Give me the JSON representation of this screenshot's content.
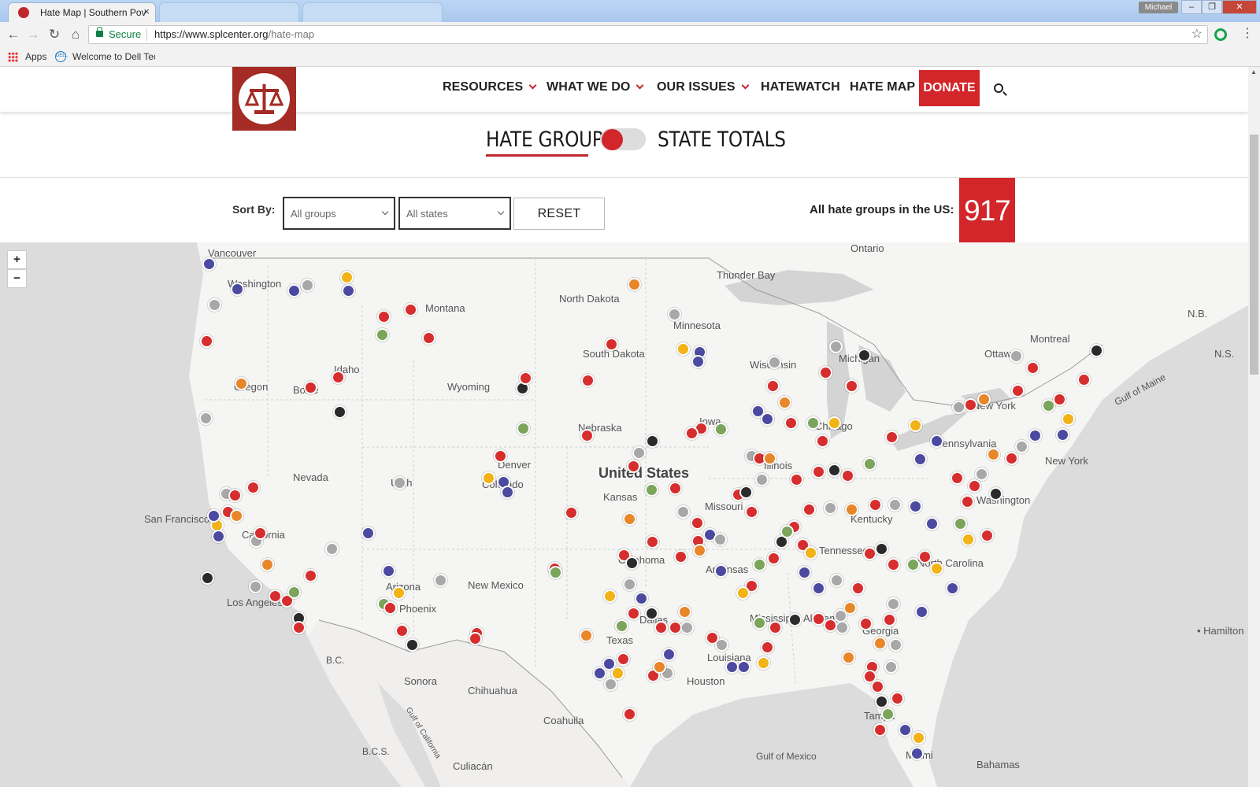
{
  "browser": {
    "tabs": [
      {
        "title": "Hate Map | Southern Pov",
        "close": "×"
      },
      {
        "title": "",
        "close": ""
      },
      {
        "title": "",
        "close": ""
      }
    ],
    "user": "Michael",
    "url_secure": "Secure",
    "url_host": "https://www.splcenter.org",
    "url_path": "/hate-map",
    "bookmarks": {
      "apps": "Apps",
      "dell": "Welcome to Dell Tech"
    }
  },
  "nav": {
    "items": [
      "RESOURCES",
      "WHAT WE DO",
      "OUR ISSUES",
      "HATEWATCH",
      "HATE MAP"
    ],
    "donate": "DONATE"
  },
  "toggle": {
    "left": "HATE GROUPS",
    "right": "STATE TOTALS"
  },
  "filters": {
    "sort_label": "Sort By:",
    "groups_value": "All groups",
    "states_value": "All states",
    "reset": "RESET"
  },
  "total": {
    "label": "All hate groups in the US:",
    "value": "917"
  },
  "map": {
    "zoom_in": "+",
    "zoom_out": "−",
    "labels": {
      "vancouver": "Vancouver",
      "washington": "Washington",
      "montana": "Montana",
      "north_dakota": "North Dakota",
      "minnesota": "Minnesota",
      "thunder_bay": "Thunder Bay",
      "ontario": "Ontario",
      "south_dakota": "South Dakota",
      "wisconsin": "Wisconsin",
      "michigan": "Michigan",
      "ottawa": "Ottawa",
      "montreal": "Montreal",
      "ns": "N.S.",
      "nb": "N.B.",
      "oregon": "Oregon",
      "boise": "Boise",
      "idaho": "Idaho",
      "wyoming": "Wyoming",
      "nebraska": "Nebraska",
      "iowa": "Iowa",
      "chicago": "Chicago",
      "new_york_state": "New York",
      "pennsylvania": "Pennsylvania",
      "new_york": "New York",
      "gulf_of_maine": "Gulf of Maine",
      "nevada": "Nevada",
      "utah": "Utah",
      "denver": "Denver",
      "colorado": "Colorado",
      "kansas": "Kansas",
      "united_states": "United States",
      "illinois": "Illinois",
      "missouri": "Missouri",
      "kentucky": "Kentucky",
      "washington_dc": "Washington",
      "san_francisco": "San Francisco",
      "california": "California",
      "oklahoma": "Oklahoma",
      "arkansas": "Arkansas",
      "tennessee": "Tennessee",
      "north_carolina": "North Carolina",
      "los_angeles": "Los Angeles",
      "arizona": "Arizona",
      "phoenix": "Phoenix",
      "new_mexico": "New Mexico",
      "dallas": "Dallas",
      "mississippi": "Mississippi",
      "alabama": "Alabama",
      "georgia": "Georgia",
      "texas": "Texas",
      "louisiana": "Louisiana",
      "houston": "Houston",
      "hamilton": "• Hamilton",
      "bc": "B.C.",
      "sonora": "Sonora",
      "chihuahua": "Chihuahua",
      "coahuila": "Coahuila",
      "bcs": "B.C.S.",
      "gulf_of_california": "Gulf of California",
      "tampa": "Tampa",
      "miami": "Miami",
      "gulf_of_mexico": "Gulf of Mexico",
      "culiacan": "Culiacán",
      "bahamas": "Bahamas"
    },
    "marker_colors": {
      "red": "#d62e2e",
      "black": "#2a2a2a",
      "purple": "#4b4aa0",
      "orange": "#e8862a",
      "green": "#7aa55a",
      "yellow": "#f2b316",
      "gray": "#a8a8a8"
    }
  }
}
